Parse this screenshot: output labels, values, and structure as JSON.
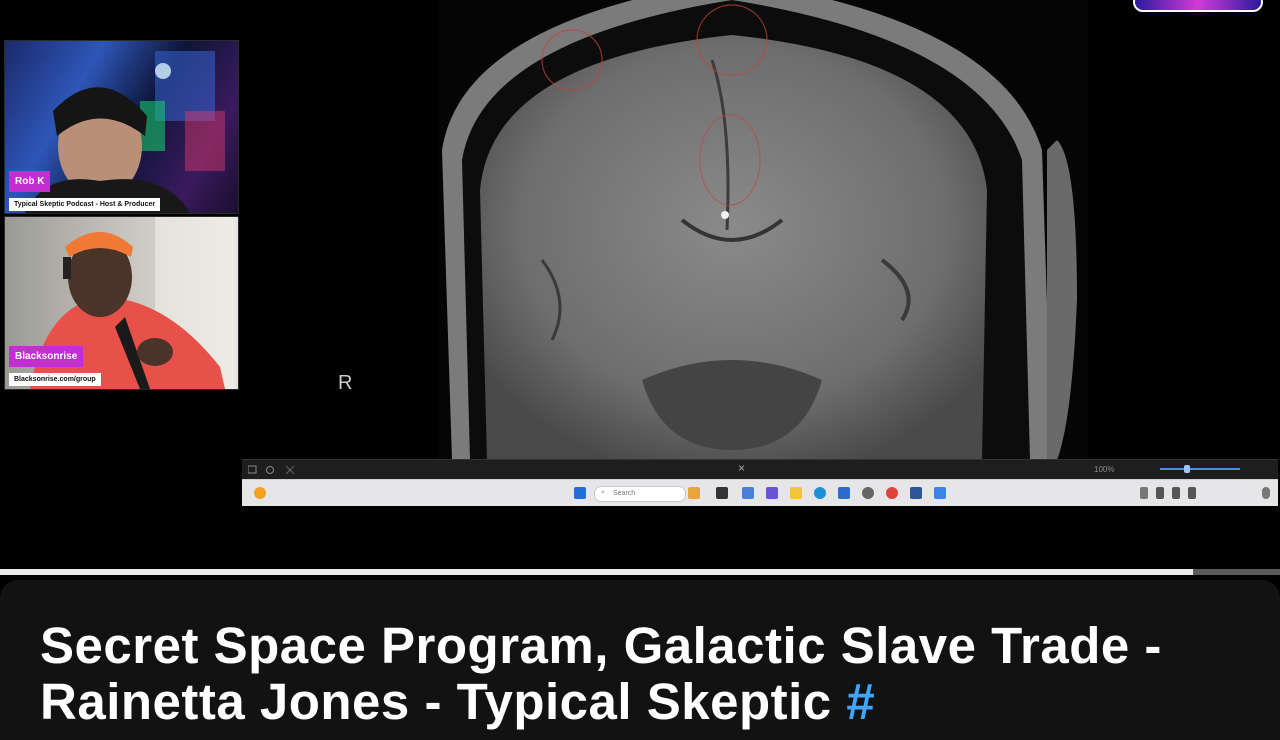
{
  "participants": [
    {
      "name": "Rob K",
      "subtitle": "Typical Skeptic Podcast - Host & Producer"
    },
    {
      "name": "Blacksonrise",
      "subtitle": "Blacksonrise.com/group"
    }
  ],
  "viewer": {
    "orientation_marker": "R",
    "toolbar": {
      "zoom": "100%",
      "close_glyph": "×"
    }
  },
  "taskbar": {
    "search_placeholder": "Search"
  },
  "progress": {
    "played_fraction": 0.932
  },
  "video": {
    "title": "Secret Space Program, Galactic Slave Trade - Rainetta Jones - Typical Skeptic",
    "hashtag": "#"
  },
  "colors": {
    "nametag": "#c22fd1",
    "hashtag_link": "#3ea6ff",
    "progress_fill": "#e9e9e9"
  },
  "icons": [
    "weather-icon",
    "windows-start-icon",
    "search-icon",
    "task-view-icon",
    "edge-icon",
    "store-icon",
    "chrome-icon",
    "file-explorer-icon",
    "settings-icon",
    "wifi-icon",
    "volume-icon",
    "battery-icon",
    "notification-icon"
  ]
}
